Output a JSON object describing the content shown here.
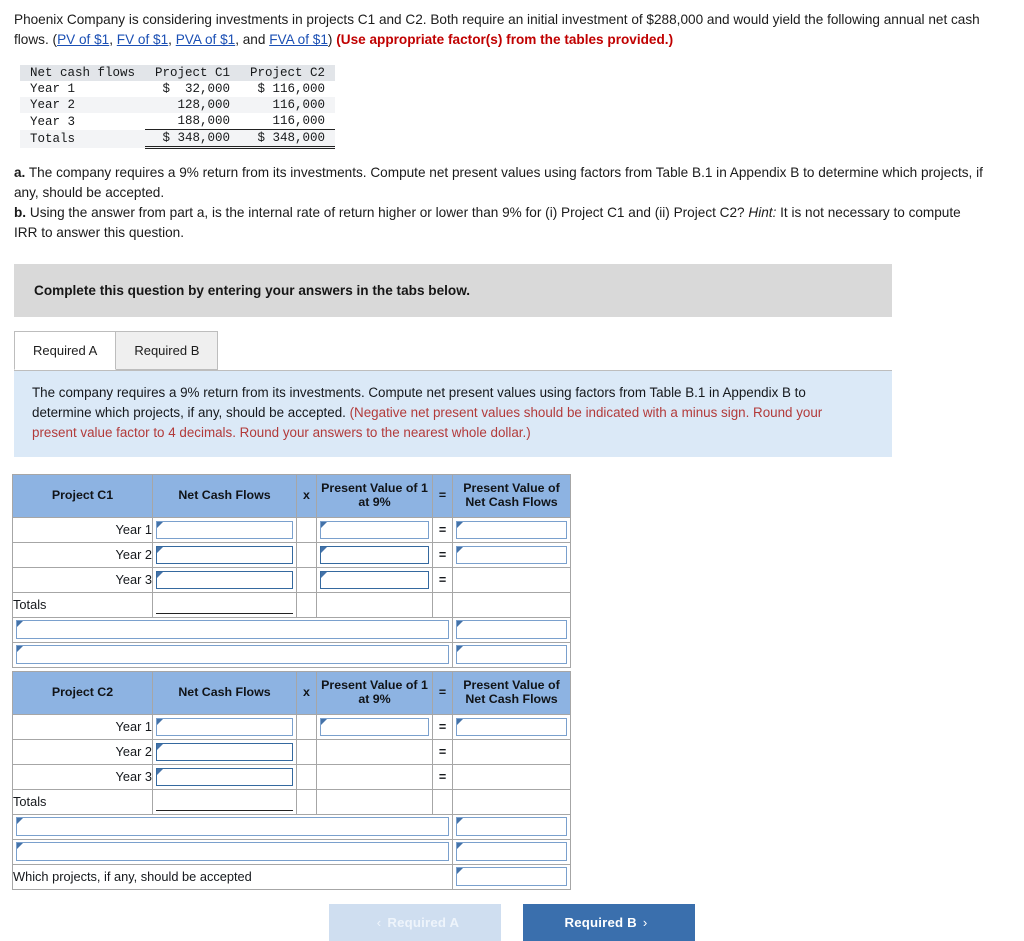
{
  "intro": {
    "sentence_part1": "Phoenix Company is considering investments in projects C1 and C2. Both require an initial investment of $288,000 and would yield the following annual net cash flows. (",
    "links": [
      "PV of $1",
      "FV of $1",
      "PVA of $1",
      "FVA of $1"
    ],
    "sep1": ", ",
    "sep2": ", ",
    "sep3": ", and ",
    "closing_paren": ")",
    "red_note": "(Use appropriate factor(s) from the tables provided.)"
  },
  "fact_table": {
    "headers": [
      "Net cash flows",
      "Project C1",
      "Project C2"
    ],
    "rows": [
      {
        "label": "Year 1",
        "c1": "$  32,000",
        "c2": "$ 116,000"
      },
      {
        "label": "Year 2",
        "c1": "128,000",
        "c2": "116,000"
      },
      {
        "label": "Year 3",
        "c1": "188,000",
        "c2": "116,000"
      }
    ],
    "totals": {
      "label": "Totals",
      "c1": "$ 348,000",
      "c2": "$ 348,000"
    }
  },
  "questions": {
    "a_marker": "a.",
    "a_text": " The company requires a 9% return from its investments. Compute net present values using factors from Table B.1 in Appendix B to determine which projects, if any, should be accepted.",
    "b_marker": "b.",
    "b_text_1": " Using the answer from part a, is the internal rate of return higher or lower than 9% for (i) Project C1 and (ii) Project C2? ",
    "b_hint_italic": "Hint:",
    "b_text_2": " It is not necessary to compute IRR to answer this question."
  },
  "banner": {
    "text": "Complete this question by entering your answers in the tabs below."
  },
  "tabs": [
    {
      "label": "Required A",
      "active": true
    },
    {
      "label": "Required B",
      "active": false
    }
  ],
  "instruction_box": {
    "black_text": "The company requires a 9% return from its investments. Compute net present values using factors from Table B.1 in Appendix B to determine which projects, if any, should be accepted. ",
    "red_text": "(Negative net present values should be indicated with a minus sign. Round your present value factor to 4 decimals. Round your answers to the nearest whole dollar.)"
  },
  "grids": [
    {
      "headers": {
        "project": "Project C1",
        "net_cash_flows": "Net Cash Flows",
        "multiply": "x",
        "pv_factor": "Present Value of 1 at 9%",
        "equals": "=",
        "pv_net_cash_flows": "Present Value of Net Cash Flows"
      },
      "rows": [
        {
          "label": "Year 1",
          "ncf": "",
          "factor": "",
          "eq": "=",
          "pv": ""
        },
        {
          "label": "Year 2",
          "ncf": "",
          "factor": "",
          "eq": "=",
          "pv": ""
        },
        {
          "label": "Year 3",
          "ncf": "",
          "factor": "",
          "eq": "=",
          "pv": ""
        }
      ],
      "totals_label": "Totals",
      "totals_ncf": "",
      "totals_pv": "",
      "span_rows": [
        {
          "label": "",
          "value": "",
          "highlight": false
        },
        {
          "label": "",
          "value": "",
          "highlight": true
        }
      ]
    },
    {
      "headers": {
        "project": "Project C2",
        "net_cash_flows": "Net Cash Flows",
        "multiply": "x",
        "pv_factor": "Present Value of 1 at 9%",
        "equals": "=",
        "pv_net_cash_flows": "Present Value of Net Cash Flows"
      },
      "rows": [
        {
          "label": "Year 1",
          "ncf": "",
          "factor": "",
          "eq": "=",
          "pv": ""
        },
        {
          "label": "Year 2",
          "ncf": "",
          "factor": "",
          "eq": "=",
          "pv": ""
        },
        {
          "label": "Year 3",
          "ncf": "",
          "factor": "",
          "eq": "=",
          "pv": ""
        }
      ],
      "totals_label": "Totals",
      "totals_ncf": "",
      "totals_pv": "",
      "span_rows": [
        {
          "label": "",
          "value": "",
          "highlight": false
        },
        {
          "label": "",
          "value": "",
          "highlight": true
        }
      ]
    }
  ],
  "final_question": {
    "label": "Which projects, if any, should be accepted",
    "value": ""
  },
  "nav": {
    "prev_label": "Required A",
    "prev_chevron": "‹",
    "next_label": "Required B",
    "next_chevron": "›"
  },
  "colors": {
    "header_blue": "#8db3e2",
    "instruction_blue": "#dbe9f7",
    "banner_grey": "#d9d9d9",
    "highlight_yellow": "#faf8c5",
    "link_blue": "#1a4fb4",
    "red_note": "#c00000",
    "hint_red": "#b23a3a",
    "button_blue": "#3a6fad",
    "button_disabled": "#cfdef0"
  }
}
